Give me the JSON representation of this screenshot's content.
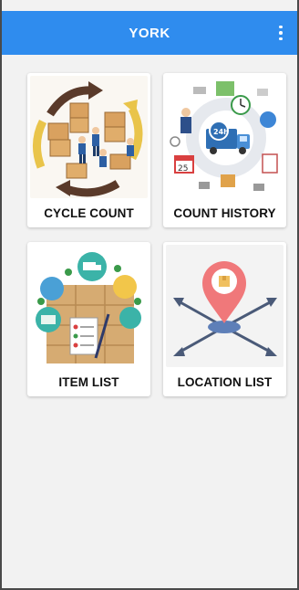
{
  "app": {
    "title": "YORK"
  },
  "colors": {
    "appbar": "#2f8cee",
    "background": "#f2f2f2",
    "card": "#ffffff"
  },
  "menu": {
    "icon": "more-vert-icon"
  },
  "tiles": [
    {
      "label": "CYCLE COUNT",
      "icon": "warehouse-workers-boxes-illustration"
    },
    {
      "label": "COUNT HISTORY",
      "icon": "delivery-truck-24h-illustration"
    },
    {
      "label": "ITEM LIST",
      "icon": "boxes-checklist-illustration"
    },
    {
      "label": "LOCATION LIST",
      "icon": "location-pin-arrows-illustration"
    }
  ]
}
